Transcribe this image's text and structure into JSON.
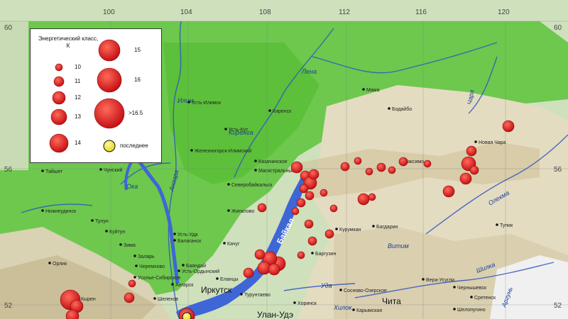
{
  "lon_ticks": [
    "100",
    "104",
    "108",
    "112",
    "116",
    "120"
  ],
  "lat_ticks": [
    "60",
    "56",
    "52"
  ],
  "legend": {
    "title": "Энергетический класс, К",
    "items": [
      "10",
      "11",
      "12",
      "13",
      "14",
      "15",
      "16",
      ">16.5",
      "последнее"
    ]
  },
  "lake_label": "Байкал",
  "rivers": [
    "Лена",
    "Чара",
    "Ангара",
    "Витим",
    "Олекма",
    "Шилка",
    "Аргунь",
    "Уда",
    "Хилок",
    "Ока",
    "Илим",
    "Киренга"
  ],
  "major_cities": [
    "Иркутск",
    "Улан-Удэ",
    "Чита"
  ],
  "towns": [
    "Усть-Илимск",
    "Киренск",
    "Усть-Кут",
    "Железногорск-Илимский",
    "Казачинское",
    "Магистральный",
    "Северобайкальск",
    "Мама",
    "Бодайбо",
    "Таксимо",
    "Новая Чара",
    "Жигалово",
    "Тайшет",
    "Чунский",
    "Нижнеудинск",
    "Тулун",
    "Куйтун",
    "Зима",
    "Заларь",
    "Черемхово",
    "Усолье-Сибирское",
    "Ангарск",
    "Шелехов",
    "Усть-Ордынский",
    "Баяндай",
    "Качуг",
    "Усть-Уда",
    "Балаганск",
    "Еланцы",
    "Турунтаево",
    "Хоринск",
    "Сосново-Озерское",
    "Курумкан",
    "Баргузин",
    "Багдарин",
    "Тупик",
    "Вера-Усугли",
    "Чернышевск",
    "Сретенск",
    "Шелопугино",
    "Карымская",
    "Орлик",
    "Кырен"
  ],
  "colors": {
    "quake": "#e0141b",
    "latest": "#f2ec2a",
    "lake": "#3f66d6",
    "legend_bg": "#ffffff"
  }
}
